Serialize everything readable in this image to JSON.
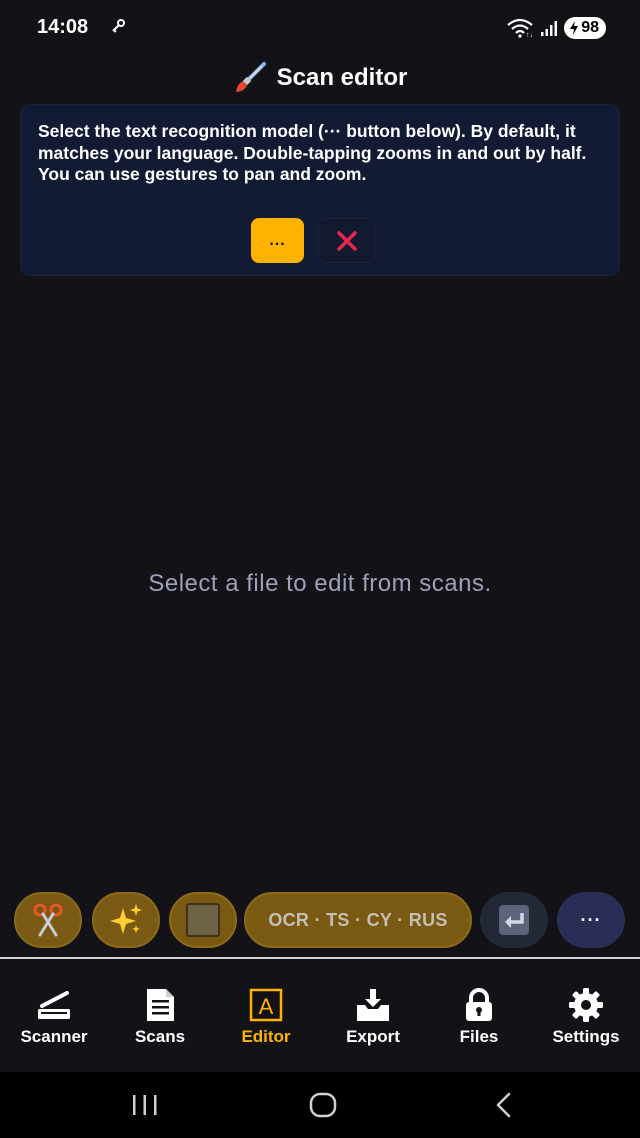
{
  "status_bar": {
    "time": "14:08",
    "battery": "98"
  },
  "header": {
    "title": "Scan editor",
    "icon": "brush-icon"
  },
  "hint": {
    "text": "Select the text recognition model (··· button below). By default, it matches your language. Double-tapping zooms in and out by half. You can use gestures to pan and zoom.",
    "more_label": "...",
    "close_icon": "close-icon"
  },
  "main": {
    "empty_message": "Select a file to edit from scans."
  },
  "toolbar": {
    "ocr_label": "OCR · TS · CY · RUS",
    "more_label": "···",
    "items": [
      "scissors-icon",
      "sparkles-icon",
      "square-icon",
      "ocr-language-button",
      "undo-icon",
      "more-icon"
    ]
  },
  "bottom_nav": {
    "items": [
      {
        "label": "Scanner",
        "icon": "scanner-icon"
      },
      {
        "label": "Scans",
        "icon": "document-icon"
      },
      {
        "label": "Editor",
        "icon": "editor-icon"
      },
      {
        "label": "Export",
        "icon": "export-icon"
      },
      {
        "label": "Files",
        "icon": "lock-icon"
      },
      {
        "label": "Settings",
        "icon": "gear-icon"
      }
    ],
    "active": "Editor"
  },
  "colors": {
    "background": "#121217",
    "accent": "#ffb300",
    "hint_background": "#121b33",
    "tool_gold": "#7a5a12",
    "close_red": "#e8264f",
    "muted_text": "#9da0b8"
  }
}
